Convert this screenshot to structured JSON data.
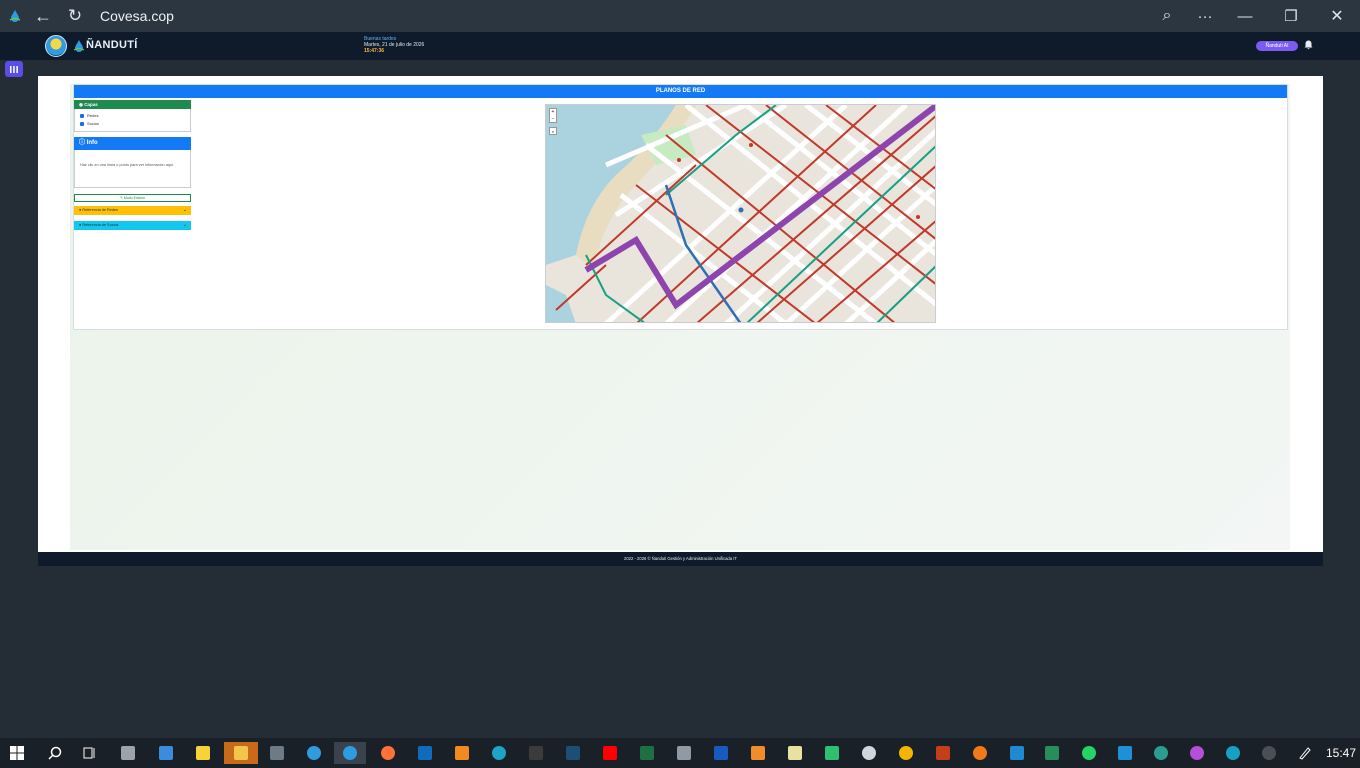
{
  "browser": {
    "title": "Covesa.cop",
    "back_icon": "←",
    "reload_icon": "↻",
    "zoom_icon": "⌕",
    "menu_icon": "···",
    "minimize_icon": "—",
    "restore_icon": "❐",
    "close_icon": "✕"
  },
  "app": {
    "brand": "ÑANDUTÍ",
    "greeting": "Buenas tardes",
    "date": "Martes, 21 de julio de 2026",
    "time": "15:47:36",
    "ai_button": "Ñanduti AI"
  },
  "panel": {
    "title": "PLANOS DE RED",
    "capas_title": "Capas",
    "layers": [
      {
        "label": "Redes",
        "checked": true
      },
      {
        "label": "Socios",
        "checked": true
      }
    ],
    "info_title": "Info",
    "info_text": "Haz clic en una línea o punto para ver información aquí.",
    "edit_button": "Modo Edición",
    "accordion_redes": "Referencia de Redes",
    "accordion_socios": "Referencia de Socios"
  },
  "map": {
    "zoom_in": "+",
    "zoom_out": "−",
    "search_icon": "⌕",
    "colors": {
      "water": "#aad3df",
      "land": "#e9e4dc",
      "road": "#ffffff",
      "network_red": "#c0392b",
      "network_purple": "#8e44ad",
      "network_green": "#16a085",
      "network_blue": "#2e6fb5",
      "park": "#c8eac3"
    }
  },
  "footer": {
    "text": "2022 - 2026 © Ñanduti Gestión y Administración Unificada IT"
  },
  "taskbar": {
    "clock": "15:47"
  }
}
